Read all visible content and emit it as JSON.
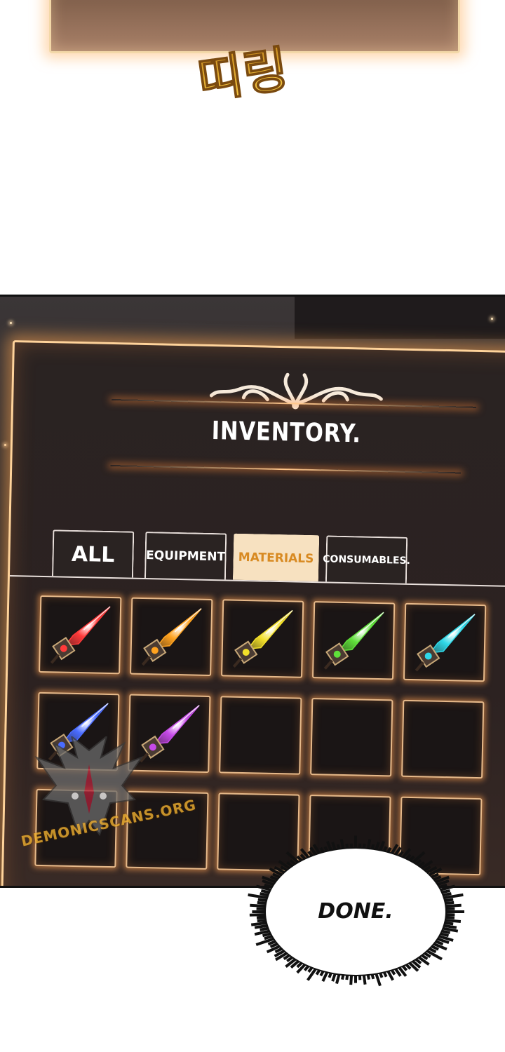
{
  "sfx": {
    "text": "띠링"
  },
  "inventory": {
    "title": "INVENTORY.",
    "tabs": [
      {
        "label": "ALL",
        "active": false
      },
      {
        "label": "EQUIPMENT",
        "active": false
      },
      {
        "label": "MATERIALS",
        "active": true
      },
      {
        "label": "CONSUMABLES.",
        "active": false
      }
    ],
    "slots": [
      {
        "item": "crystal-shard-icon",
        "color": "#ff3a3a"
      },
      {
        "item": "crystal-shard-icon",
        "color": "#ffa21f"
      },
      {
        "item": "crystal-shard-icon",
        "color": "#f3e02a"
      },
      {
        "item": "crystal-shard-icon",
        "color": "#5fe03a"
      },
      {
        "item": "crystal-shard-icon",
        "color": "#2fd8e8"
      },
      {
        "item": "crystal-shard-icon",
        "color": "#4a6cff"
      },
      {
        "item": "crystal-shard-icon",
        "color": "#c64ae8"
      },
      {
        "item": "empty"
      },
      {
        "item": "empty"
      },
      {
        "item": "empty"
      },
      {
        "item": "empty"
      },
      {
        "item": "empty"
      },
      {
        "item": "empty"
      },
      {
        "item": "empty"
      },
      {
        "item": "empty"
      }
    ],
    "colors": {
      "frame_glow": "#ffa24f",
      "active_tab_bg": "#f7e1c0",
      "active_tab_text": "#d88a22"
    }
  },
  "watermark": {
    "text": "DEMONICSCANS.ORG"
  },
  "speech": {
    "text": "DONE."
  }
}
